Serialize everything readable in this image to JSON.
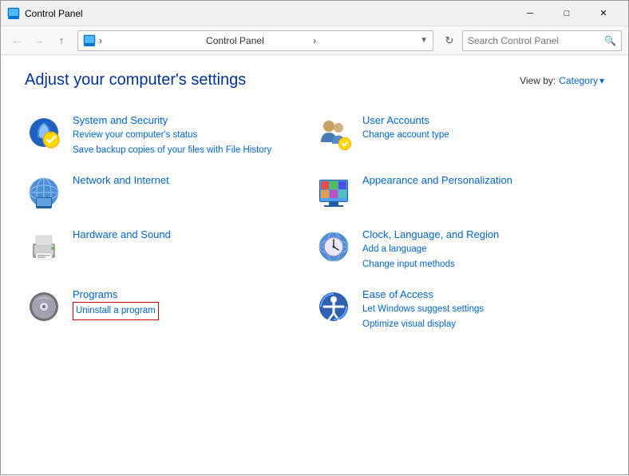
{
  "titleBar": {
    "icon": "🖥",
    "title": "Control Panel",
    "minimizeLabel": "─",
    "maximizeLabel": "□",
    "closeLabel": "✕"
  },
  "navBar": {
    "backLabel": "←",
    "forwardLabel": "→",
    "upLabel": "↑",
    "refreshLabel": "↻",
    "addressDropdownLabel": "▾",
    "addressText": "Control Panel",
    "addressSeparator": "›",
    "searchPlaceholder": "Search Control Panel",
    "searchIconLabel": "🔍"
  },
  "viewBy": {
    "label": "View by:",
    "value": "Category",
    "chevron": "▾"
  },
  "pageTitle": "Adjust your computer's settings",
  "categories": [
    {
      "id": "system-security",
      "title": "System and Security",
      "links": [
        "Review your computer's status",
        "Save backup copies of your files with File History"
      ],
      "highlightedLink": null
    },
    {
      "id": "user-accounts",
      "title": "User Accounts",
      "links": [
        "Change account type"
      ],
      "highlightedLink": null
    },
    {
      "id": "network-internet",
      "title": "Network and Internet",
      "links": [],
      "highlightedLink": null
    },
    {
      "id": "appearance",
      "title": "Appearance and Personalization",
      "links": [],
      "highlightedLink": null
    },
    {
      "id": "hardware-sound",
      "title": "Hardware and Sound",
      "links": [],
      "highlightedLink": null
    },
    {
      "id": "clock-language",
      "title": "Clock, Language, and Region",
      "links": [
        "Add a language",
        "Change input methods"
      ],
      "highlightedLink": null
    },
    {
      "id": "programs",
      "title": "Programs",
      "links": [
        "Uninstall a program"
      ],
      "highlightedLink": "Uninstall a program"
    },
    {
      "id": "ease-of-access",
      "title": "Ease of Access",
      "links": [
        "Let Windows suggest settings",
        "Optimize visual display"
      ],
      "highlightedLink": null
    }
  ]
}
